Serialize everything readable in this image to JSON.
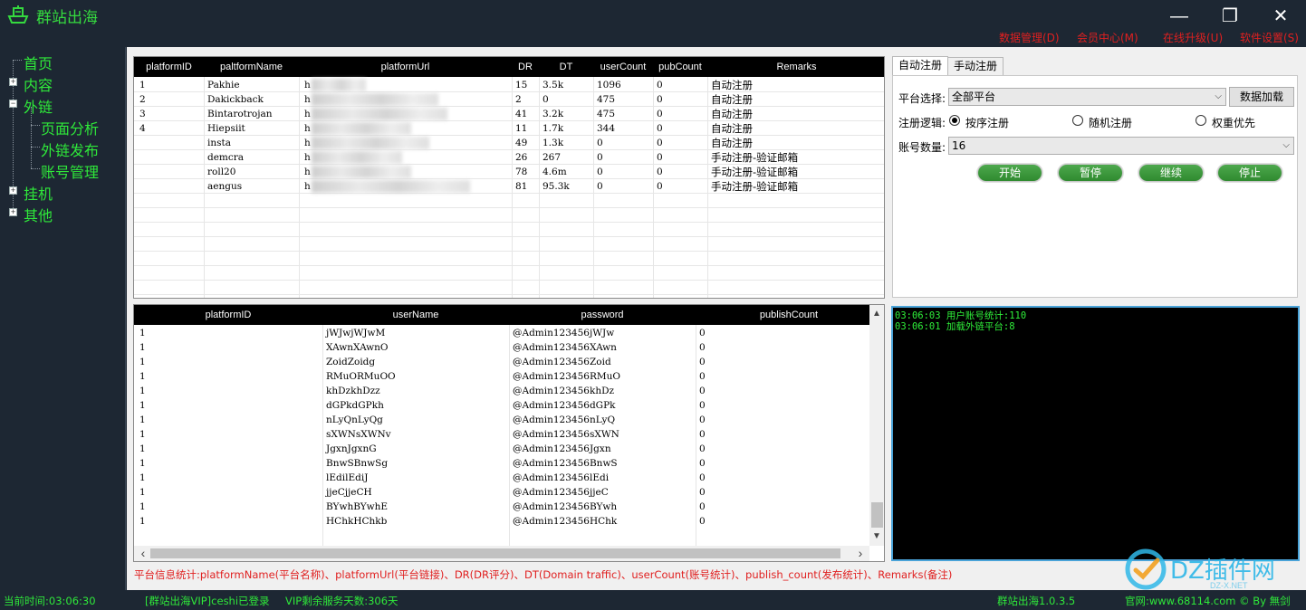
{
  "app": {
    "title": "群站出海"
  },
  "menu": {
    "data_manage": "数据管理(D)",
    "member": "会员中心(M)",
    "upgrade": "在线升级(U)",
    "settings": "软件设置(S)"
  },
  "window_controls": {
    "minimize": "—",
    "maximize": "❐",
    "close": "✕"
  },
  "sidebar": {
    "home": "首页",
    "content": "内容",
    "backlinks": "外链",
    "page_analysis": "页面分析",
    "link_publish": "外链发布",
    "account_manage": "账号管理",
    "hangup": "挂机",
    "other": "其他",
    "expand": "+",
    "collapse": "−"
  },
  "platform_table": {
    "headers": [
      "platformID",
      "paltformName",
      "platformUrl",
      "DR",
      "DT",
      "userCount",
      "pubCount",
      "Remarks"
    ],
    "rows": [
      {
        "id": "1",
        "name": "Pakhie",
        "url": "h",
        "dr": "15",
        "dt": "3.5k",
        "users": "1096",
        "pub": "0",
        "remarks": "自动注册"
      },
      {
        "id": "2",
        "name": "Dakickback",
        "url": "h",
        "dr": "2",
        "dt": "0",
        "users": "475",
        "pub": "0",
        "remarks": "自动注册"
      },
      {
        "id": "3",
        "name": "Bintarotrojan",
        "url": "h",
        "dr": "41",
        "dt": "3.2k",
        "users": "475",
        "pub": "0",
        "remarks": "自动注册"
      },
      {
        "id": "4",
        "name": "Hiepsiit",
        "url": "h",
        "dr": "11",
        "dt": "1.7k",
        "users": "344",
        "pub": "0",
        "remarks": "自动注册"
      },
      {
        "id": "",
        "name": "insta",
        "url": "h",
        "dr": "49",
        "dt": "1.3k",
        "users": "0",
        "pub": "0",
        "remarks": "自动注册"
      },
      {
        "id": "",
        "name": "demcra",
        "url": "h",
        "dr": "26",
        "dt": "267",
        "users": "0",
        "pub": "0",
        "remarks": "手动注册-验证邮箱"
      },
      {
        "id": "",
        "name": "roll20",
        "url": "h",
        "dr": "78",
        "dt": "4.6m",
        "users": "0",
        "pub": "0",
        "remarks": "手动注册-验证邮箱"
      },
      {
        "id": "",
        "name": "aengus",
        "url": "h",
        "dr": "81",
        "dt": "95.3k",
        "users": "0",
        "pub": "0",
        "remarks": "手动注册-验证邮箱"
      }
    ]
  },
  "account_table": {
    "headers": [
      "platformID",
      "userName",
      "password",
      "publishCount"
    ],
    "rows": [
      {
        "id": "1",
        "user": "jWJwjWJwM",
        "pass": "@Admin123456jWJw",
        "count": "0"
      },
      {
        "id": "1",
        "user": "XAwnXAwnO",
        "pass": "@Admin123456XAwn",
        "count": "0"
      },
      {
        "id": "1",
        "user": "ZoidZoidg",
        "pass": "@Admin123456Zoid",
        "count": "0"
      },
      {
        "id": "1",
        "user": "RMuORMuOO",
        "pass": "@Admin123456RMuO",
        "count": "0"
      },
      {
        "id": "1",
        "user": "khDzkhDzz",
        "pass": "@Admin123456khDz",
        "count": "0"
      },
      {
        "id": "1",
        "user": "dGPkdGPkh",
        "pass": "@Admin123456dGPk",
        "count": "0"
      },
      {
        "id": "1",
        "user": "nLyQnLyQg",
        "pass": "@Admin123456nLyQ",
        "count": "0"
      },
      {
        "id": "1",
        "user": "sXWNsXWNv",
        "pass": "@Admin123456sXWN",
        "count": "0"
      },
      {
        "id": "1",
        "user": "JgxnJgxnG",
        "pass": "@Admin123456Jgxn",
        "count": "0"
      },
      {
        "id": "1",
        "user": "BnwSBnwSg",
        "pass": "@Admin123456BnwS",
        "count": "0"
      },
      {
        "id": "1",
        "user": "lEdilEdiJ",
        "pass": "@Admin123456lEdi",
        "count": "0"
      },
      {
        "id": "1",
        "user": "jjeCjjeCH",
        "pass": "@Admin123456jjeC",
        "count": "0"
      },
      {
        "id": "1",
        "user": "BYwhBYwhE",
        "pass": "@Admin123456BYwh",
        "count": "0"
      },
      {
        "id": "1",
        "user": "HChkHChkb",
        "pass": "@Admin123456HChk",
        "count": "0"
      }
    ]
  },
  "scroll_arrows": {
    "up": "▲",
    "down": "▼",
    "left": "‹",
    "right": "›"
  },
  "register": {
    "tab_auto": "自动注册",
    "tab_manual": "手动注册",
    "platform_label": "平台选择:",
    "platform_value": "全部平台",
    "load_button": "数据加载",
    "logic_label": "注册逻辑:",
    "logic_options": [
      "按序注册",
      "随机注册",
      "权重优先"
    ],
    "count_label": "账号数量:",
    "count_value": "16",
    "dropdown_arrow": "⌵",
    "start": "开始",
    "pause": "暂停",
    "resume": "继续",
    "stop": "停止"
  },
  "log": {
    "lines": [
      "03:06:03 用户账号统计:110",
      "03:06:01 加载外链平台:8"
    ]
  },
  "stats_text": "平台信息统计:platformName(平台名称)、platformUrl(平台链接)、DR(DR评分)、DT(Domain traffic)、userCount(账号统计)、publish_count(发布统计)、Remarks(备注)",
  "statusbar": {
    "time": "当前时间:03:06:30",
    "login": "[群站出海VIP]ceshi已登录",
    "vip_days": "VIP剩余服务天数:306天",
    "version": "群站出海1.0.3.5",
    "site": "官网:www.68114.com © By 無剑"
  },
  "watermark": {
    "text": "DZ插件网",
    "sub": "DZ-X.NET"
  },
  "colors": {
    "accent_green": "#2fe83a",
    "menu_red": "#e02020",
    "dark_bg": "#1d2733",
    "log_border": "#4aa3d8"
  }
}
